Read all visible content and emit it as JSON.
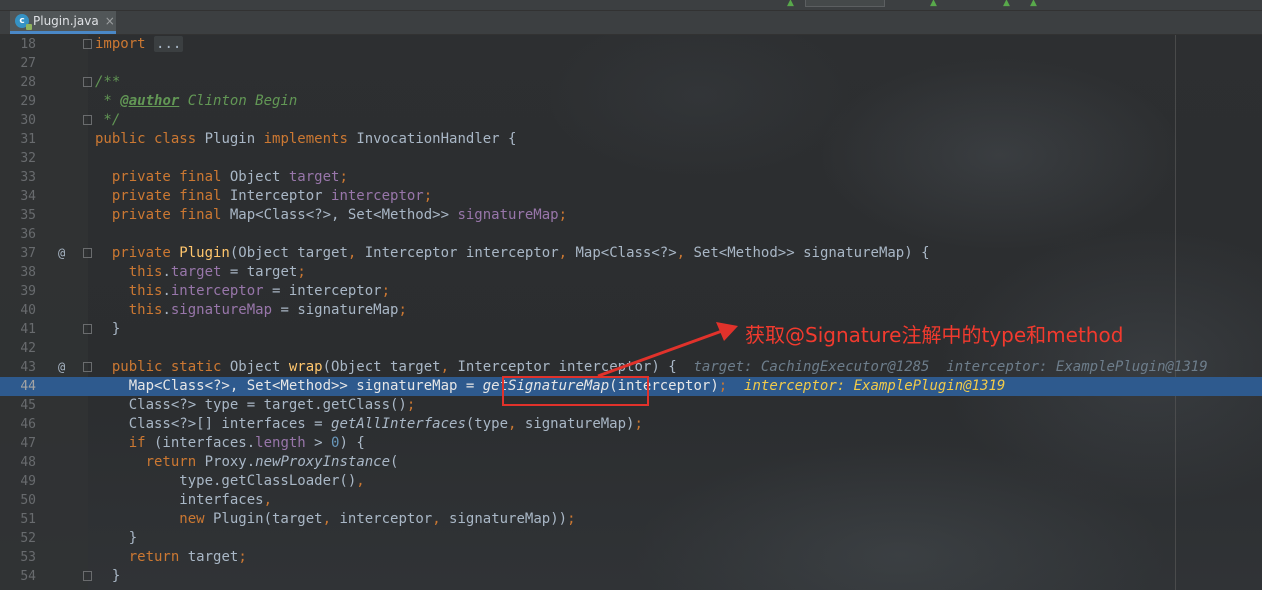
{
  "tab": {
    "label": "Plugin.java",
    "icon": "java-class-icon",
    "icon_letter": "c",
    "close": "×"
  },
  "annotation": {
    "text": "获取@Signature注解中的type和method",
    "color": "#e1322b"
  },
  "lines": [
    {
      "num": "18"
    },
    {
      "num": "27"
    },
    {
      "num": "28"
    },
    {
      "num": "29"
    },
    {
      "num": "30"
    },
    {
      "num": "31"
    },
    {
      "num": "32"
    },
    {
      "num": "33"
    },
    {
      "num": "34"
    },
    {
      "num": "35"
    },
    {
      "num": "36"
    },
    {
      "num": "37",
      "marker": "@"
    },
    {
      "num": "38"
    },
    {
      "num": "39"
    },
    {
      "num": "40"
    },
    {
      "num": "41"
    },
    {
      "num": "42"
    },
    {
      "num": "43",
      "marker": "@"
    },
    {
      "num": "44"
    },
    {
      "num": "45"
    },
    {
      "num": "46"
    },
    {
      "num": "47"
    },
    {
      "num": "48"
    },
    {
      "num": "49"
    },
    {
      "num": "50"
    },
    {
      "num": "51"
    },
    {
      "num": "52"
    },
    {
      "num": "53"
    },
    {
      "num": "54"
    }
  ],
  "code": {
    "l18_kw": "import",
    "l18_fold": "...",
    "l28": "/**",
    "l29_star": " * ",
    "l29_tag": "@author",
    "l29_rest": " Clinton Begin",
    "l30": " */",
    "l31_kw1": "public class",
    "l31_name": " Plugin ",
    "l31_kw2": "implements",
    "l31_rest": " InvocationHandler {",
    "l33_kw": "  private final",
    "l33_type": " Object ",
    "l33_fld": "target",
    "l33_semi": ";",
    "l34_kw": "  private final",
    "l34_type": " Interceptor ",
    "l34_fld": "interceptor",
    "l34_semi": ";",
    "l35_kw": "  private final",
    "l35_type": " Map<Class<?>, Set<Method>> ",
    "l35_fld": "signatureMap",
    "l35_semi": ";",
    "l37_kw": "  private",
    "l37_fn": " Plugin",
    "l37_a": "(Object target",
    "l37_c1": ",",
    "l37_b": " Interceptor interceptor",
    "l37_c2": ",",
    "l37_c": " Map<Class<?>",
    "l37_c3": ",",
    "l37_d": " Set<Method>> signatureMap) {",
    "l38_kw": "    this",
    "l38_dot": ".",
    "l38_fld": "target",
    "l38_rest": " = target",
    "l38_semi": ";",
    "l39_kw": "    this",
    "l39_dot": ".",
    "l39_fld": "interceptor",
    "l39_rest": " = interceptor",
    "l39_semi": ";",
    "l40_kw": "    this",
    "l40_dot": ".",
    "l40_fld": "signatureMap",
    "l40_rest": " = signatureMap",
    "l40_semi": ";",
    "l41": "  }",
    "l43_kw": "  public static",
    "l43_type": " Object ",
    "l43_fn": "wrap",
    "l43_a": "(Object target",
    "l43_c": ",",
    "l43_b": " Interceptor interceptor) {  ",
    "l43_hint": "target: CachingExecutor@1285  interceptor: ExamplePlugin@1319",
    "l44_a": "    Map<Class<?>, Set<Method>> signatureMap = ",
    "l44_call": "getSignatureMap",
    "l44_b": "(interceptor)",
    "l44_semi": ";",
    "l44_hint": "  interceptor: ExamplePlugin@1319",
    "l45_a": "    Class<?> type = target.getClass()",
    "l45_semi": ";",
    "l46_a": "    Class<?>[] interfaces = ",
    "l46_call": "getAllInterfaces",
    "l46_b": "(type",
    "l46_c": ",",
    "l46_d": " signatureMap)",
    "l46_semi": ";",
    "l47_kw": "    if",
    "l47_a": " (interfaces.",
    "l47_fld": "length",
    "l47_b": " > ",
    "l47_num": "0",
    "l47_c": ") {",
    "l48_kw": "      return",
    "l48_a": " Proxy.",
    "l48_call": "newProxyInstance",
    "l48_b": "(",
    "l49_a": "          type.getClassLoader()",
    "l49_c": ",",
    "l50_a": "          interfaces",
    "l50_c": ",",
    "l51_kw": "          new",
    "l51_a": " Plugin(target",
    "l51_c1": ",",
    "l51_b": " interceptor",
    "l51_c2": ",",
    "l51_d": " signatureMap))",
    "l51_semi": ";",
    "l52": "    }",
    "l53_kw": "    return",
    "l53_a": " target",
    "l53_semi": ";",
    "l54": "  }"
  }
}
